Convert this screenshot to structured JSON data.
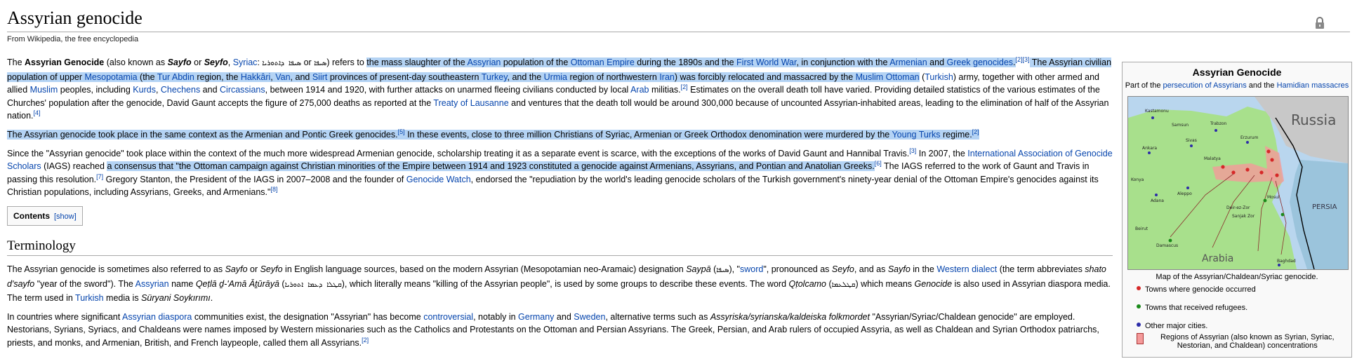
{
  "title": "Assyrian genocide",
  "subtitle": "From Wikipedia, the free encyclopedia",
  "lead": {
    "p1": {
      "t1": "The ",
      "bold": "Assyrian Genocide",
      "t2": " (also known as ",
      "it1": "Sayfo",
      "t3": " or ",
      "it2": "Seyfo",
      "t4": ", ",
      "link_syriac": "Syriac",
      "t5": ": ",
      "syriac1": "ܣܝܦܐ ܕܐܬܘܪܝܐ",
      "t6": " or ",
      "syriac2": "ܣܝܦܐ",
      "t7": ") refers to ",
      "h1": "the mass slaughter of the ",
      "link_assyrian": "Assyrian",
      "h2": " population of the ",
      "link_ottoman": "Ottoman Empire",
      "h3": " during the 1890s and the ",
      "link_ww1": "First World War",
      "h4": ", in conjunction with the ",
      "link_armenian": "Armenian",
      "h5": " and ",
      "link_greek": "Greek genocides",
      "ref23": "[2][3]",
      "h6": " The Assyrian civilian population of upper ",
      "link_mesopotamia": "Mesopotamia",
      "h7": " (the ",
      "link_turabdin": "Tur Abdin",
      "h8": " region, the ",
      "link_hakkari": "Hakkâri",
      "h9": ", ",
      "link_van": "Van",
      "h10": ", and ",
      "link_siirt": "Siirt",
      "h11": " provinces of present-day southeastern ",
      "link_turkey": "Turkey",
      "h12": ", and the ",
      "link_urmia": "Urmia",
      "h13": " region of northwestern ",
      "link_iran": "Iran",
      "h14": ") was forcibly relocated and massacred by the ",
      "link_muslimottoman": "Muslim Ottoman",
      "h15": " (",
      "link_turkish": "Turkish",
      "h16": ") army, together with other armed and allied ",
      "link_muslim": "Muslim",
      "h17": " peoples, including ",
      "link_kurds": "Kurds",
      "h18": ", ",
      "link_chechens": "Chechens",
      "h19": " and ",
      "link_circassians": "Circassians",
      "h20": ", between 1914 and 1920, with further attacks on unarmed fleeing civilians conducted by local ",
      "link_arab": "Arab",
      "h21": " militias.",
      "ref2": "[2]",
      "t8": " Estimates on the overall death toll have varied. Providing detailed statistics of the various estimates of the Churches' population after the genocide, David Gaunt accepts the figure of 275,000 deaths as reported at the ",
      "link_lausanne": "Treaty of Lausanne",
      "t9": " and ventures that the death toll would be around 300,000 because of uncounted Assyrian-inhabited areas, leading to the elimination of half of the Assyrian nation.",
      "ref4": "[4]"
    },
    "p2": {
      "t1": "The Assyrian genocide took place in the same context as the Armenian and Pontic Greek genocides.",
      "ref5": "[5]",
      "t2": " In these events, close to three million Christians of Syriac, Armenian or Greek Orthodox denomination were murdered by the ",
      "link_youngturks": "Young Turks",
      "t3": " regime.",
      "ref2": "[2]"
    },
    "p3": {
      "t1": "Since the \"Assyrian genocide\" took place within the context of the much more widespread Armenian genocide, scholarship treating it as a separate event is scarce, with the exceptions of the works of David Gaunt and Hannibal Travis.",
      "ref3": "[3]",
      "t2": " In 2007, the ",
      "link_iags": "International Association of Genocide Scholars",
      "t3": " (IAGS) reached ",
      "h1": "a consensus that \"the Ottoman campaign against Christian minorities of the Empire between 1914 and 1923 constituted a genocide against Armenians, Assyrians, and Pontian and Anatolian Greeks.",
      "ref6": "[6]",
      "t4": " The IAGS referred to the work of Gaunt and Travis in passing this resolution.",
      "ref7": "[7]",
      "t5": " Gregory Stanton, the President of the IAGS in 2007–2008 and the founder of ",
      "link_gw": "Genocide Watch",
      "t6": ", endorsed the \"repudiation by the world's leading genocide scholars of the Turkish government's ninety-year denial of the Ottoman Empire's genocides against its Christian populations, including Assyrians, Greeks, and Armenians.\"",
      "ref8": "[8]"
    }
  },
  "toc": {
    "label": "Contents",
    "toggle": "[show]"
  },
  "terminology": {
    "heading": "Terminology",
    "p1": {
      "t1": "The Assyrian genocide is sometimes also referred to as ",
      "it1": "Sayfo",
      "t2": " or ",
      "it2": "Seyfo",
      "t3": " in English language sources, based on the modern Assyrian (Mesopotamian neo-Aramaic) designation ",
      "it3": "Saypā",
      "t4": " (",
      "syr1": "ܣܝܦܐ",
      "t5": "), \"",
      "link_sword": "sword",
      "t6": "\", pronounced as ",
      "it4": "Seyfo",
      "t7": ", and as ",
      "it5": "Sayfo",
      "t8": " in the ",
      "link_western": "Western dialect",
      "t9": " (the term abbreviates ",
      "it6": "shato d'sayfo",
      "t10": " \"year of the sword\"). The ",
      "link_assyrian": "Assyrian",
      "t11": " name ",
      "it7": "Qeṭlā ḏ-'Amā Āṯūrāyā",
      "t12": " (",
      "syr2": "ܩܛܠܐ ܕܥܡܐ ܐܬܘܪܝܐ",
      "t13": "), which literally means \"killing of the Assyrian people\", is used by some groups to describe these events. The word ",
      "it8": "Qṭolcamo",
      "t14": " (",
      "syr3": "ܩܛܠܥܡܐ",
      "t15": ") which means ",
      "it9": "Genocide",
      "t16": " is also used in Assyrian diaspora media. The term used in ",
      "link_turkish": "Turkish",
      "t17": " media is ",
      "it10": "Süryani Soykırımı",
      "t18": "."
    },
    "p2": {
      "t1": "In countries where significant ",
      "link_diaspora": "Assyrian diaspora",
      "t2": " communities exist, the designation \"Assyrian\" has become ",
      "link_controversial": "controversial",
      "t3": ", notably in ",
      "link_germany": "Germany",
      "t4": " and ",
      "link_sweden": "Sweden",
      "t5": ", alternative terms such as ",
      "it1": "Assyriska/syrianska/kaldeiska folkmordet",
      "t6": " \"Assyrian/Syriac/Chaldean genocide\" are employed. Nestorians, Syrians, Syriacs, and Chaldeans were names imposed by Western missionaries such as the Catholics and Protestants on the Ottoman and Persian Assyrians. The Greek, Persian, and Arab rulers of occupied Assyria, as well as Chaldean and Syrian Orthodox patriarchs, priests, and monks, and Armenian, British, and French laypeople, called them all Assyrians.",
      "ref2": "[2]"
    }
  },
  "infobox": {
    "title": "Assyrian Genocide",
    "part_of_pre": "Part of the ",
    "link_persecution": "persecution of Assyrians",
    "part_of_mid": " and the ",
    "link_hamidian": "Hamidian massacres",
    "map_labels": {
      "russia": "Russia",
      "persia": "PERSIA",
      "arabia": "Arabia",
      "kastamonu": "Kastamonu",
      "trabzon": "Trabzon",
      "samsun": "Samsun",
      "ankara": "Ankara",
      "sivas": "Sivas",
      "erzurum": "Erzurum",
      "konya": "Konya",
      "malatya": "Malatya",
      "adana": "Adana",
      "aleppo": "Aleppo",
      "mosul": "Mosul",
      "deir": "Deir-ez-Zor",
      "sanjak": "Sanjak Zor",
      "baghdad": "Baghdad",
      "damascus": "Damascus",
      "beirut": "Beirut"
    },
    "colors": {
      "land": "#a8e08c",
      "sea": "#b9d6ee",
      "russia": "#c8c8c8",
      "persia": "#9bc4dc",
      "massacre": "#d62828",
      "refuge": "#1a8a1a",
      "city": "#2c2ca8"
    },
    "caption": "Map of the Assyrian/Chaldean/Syriac genocide.",
    "legend": {
      "red": "Towns where genocide occurred",
      "green": "Towns that received refugees.",
      "blue": "Other major cities.",
      "region": "Regions of Assyrian (also known as Syrian, Syriac, Nestorian, and Chaldean) concentrations"
    }
  }
}
